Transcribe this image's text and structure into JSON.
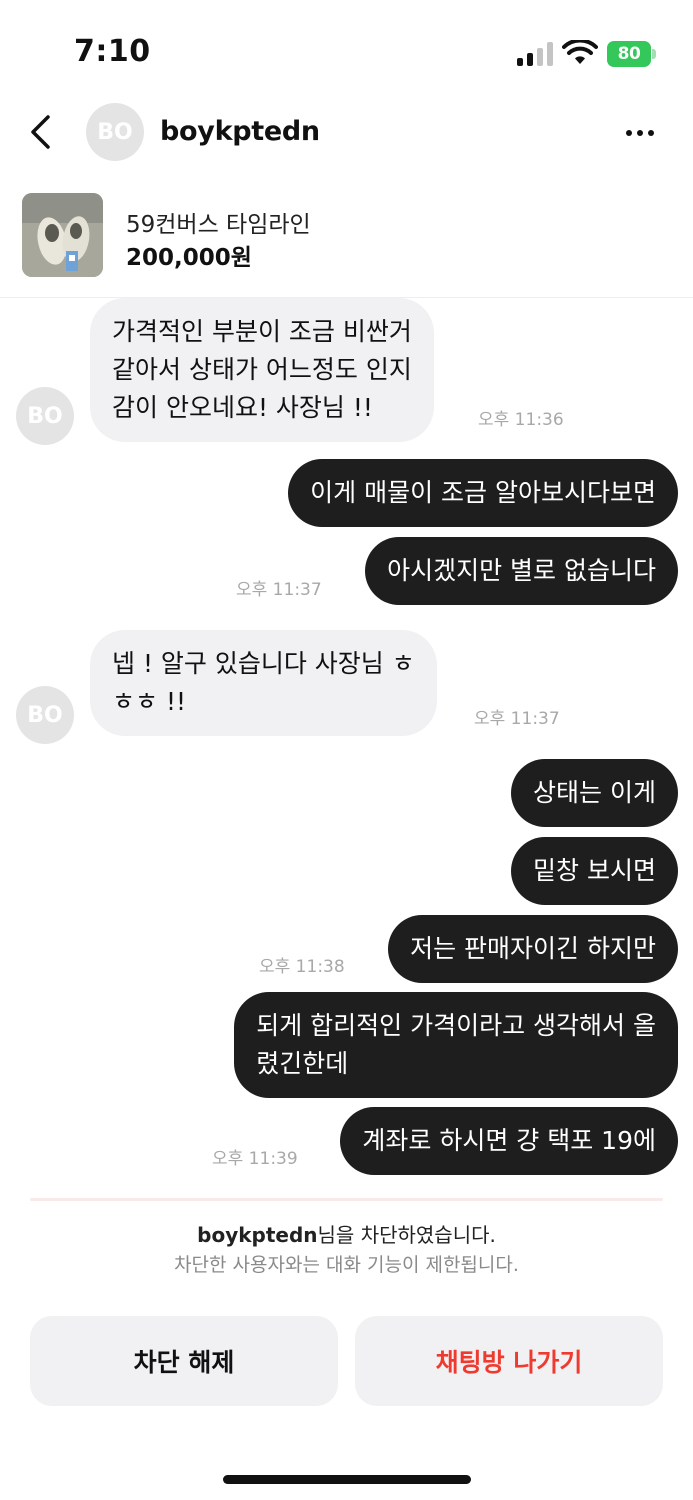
{
  "status_bar": {
    "time": "7:10",
    "battery": "80"
  },
  "header": {
    "avatar_initials": "BO",
    "username": "boykptedn"
  },
  "product": {
    "name": "59컨버스 타임라인",
    "price": "200,000원"
  },
  "messages": [
    {
      "from": "other",
      "lines": [
        "가격적인 부분이 조금 비싼거",
        "같아서 상태가 어느정도 인지",
        "감이 안오네요! 사장님 !!"
      ],
      "time": "오후 11:36"
    },
    {
      "from": "me",
      "lines": [
        "이게 매물이 조금 알아보시다보면"
      ]
    },
    {
      "from": "me",
      "lines": [
        "아시겠지만 별로 없습니다"
      ],
      "time": "오후 11:37"
    },
    {
      "from": "other",
      "lines": [
        "넵 ! 알구 있습니다 사장님 ㅎ",
        "ㅎㅎ !!"
      ],
      "time": "오후 11:37"
    },
    {
      "from": "me",
      "lines": [
        "상태는 이게"
      ]
    },
    {
      "from": "me",
      "lines": [
        "밑창 보시면"
      ]
    },
    {
      "from": "me",
      "lines": [
        "저는 판매자이긴 하지만"
      ],
      "time": "오후 11:38"
    },
    {
      "from": "me",
      "lines": [
        "되게 합리적인 가격이라고 생각해서 올",
        "렸긴한데"
      ]
    },
    {
      "from": "me",
      "lines": [
        "계좌로 하시면 걍 택포 19에"
      ],
      "time": "오후 11:39"
    }
  ],
  "notice": {
    "username": "boykptedn",
    "main_suffix": "님을 차단하였습니다.",
    "sub": "차단한 사용자와는 대화 기능이 제한됩니다."
  },
  "buttons": {
    "unblock": "차단 해제",
    "leave": "채팅방 나가기"
  },
  "colors": {
    "accent_red": "#ee3b30",
    "bubble_out": "#1e1e1e",
    "bubble_in": "#f1f1f3",
    "battery_green": "#34c759"
  }
}
